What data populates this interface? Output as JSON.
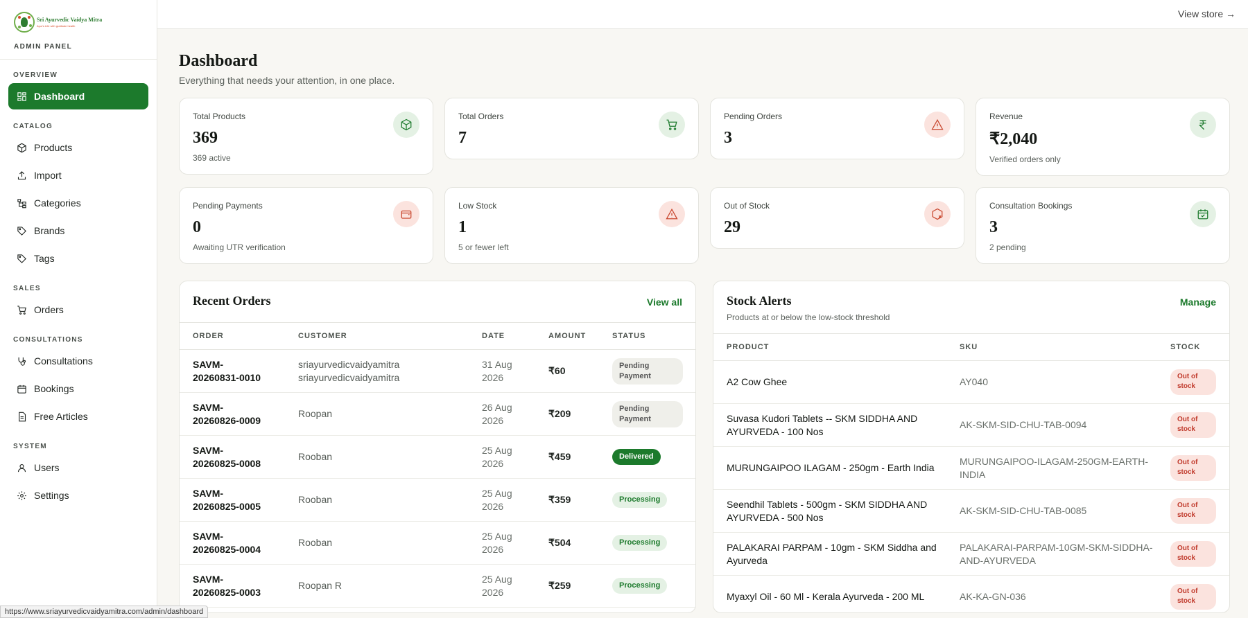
{
  "brand": {
    "logo_name": "Sri Ayurvedic Vaidya Mitra",
    "logo_tag": "Ayur's Life with gratitude health",
    "panel_label": "ADMIN PANEL"
  },
  "sidebar": {
    "sections": [
      {
        "title": "OVERVIEW",
        "items": [
          {
            "label": "Dashboard",
            "icon": "dashboard-icon",
            "active": true
          }
        ]
      },
      {
        "title": "CATALOG",
        "items": [
          {
            "label": "Products",
            "icon": "box-icon"
          },
          {
            "label": "Import",
            "icon": "upload-icon"
          },
          {
            "label": "Categories",
            "icon": "tree-icon"
          },
          {
            "label": "Brands",
            "icon": "tag-icon"
          },
          {
            "label": "Tags",
            "icon": "tags-icon"
          }
        ]
      },
      {
        "title": "SALES",
        "items": [
          {
            "label": "Orders",
            "icon": "cart-icon"
          }
        ]
      },
      {
        "title": "CONSULTATIONS",
        "items": [
          {
            "label": "Consultations",
            "icon": "stethoscope-icon"
          },
          {
            "label": "Bookings",
            "icon": "calendar-icon"
          },
          {
            "label": "Free Articles",
            "icon": "document-icon"
          }
        ]
      },
      {
        "title": "SYSTEM",
        "items": [
          {
            "label": "Users",
            "icon": "user-icon"
          },
          {
            "label": "Settings",
            "icon": "gear-icon"
          }
        ]
      }
    ]
  },
  "topbar": {
    "view_store": "View store →"
  },
  "page": {
    "title": "Dashboard",
    "subtitle": "Everything that needs your attention, in one place."
  },
  "stats": [
    {
      "label": "Total Products",
      "value": "369",
      "note": "369 active",
      "icon": "box-icon",
      "tone": "green"
    },
    {
      "label": "Total Orders",
      "value": "7",
      "note": "",
      "icon": "cart-icon",
      "tone": "green"
    },
    {
      "label": "Pending Orders",
      "value": "3",
      "note": "",
      "icon": "warning-icon",
      "tone": "red"
    },
    {
      "label": "Revenue",
      "value": "₹2,040",
      "note": "Verified orders only",
      "icon": "rupee-icon",
      "tone": "green"
    },
    {
      "label": "Pending Payments",
      "value": "0",
      "note": "Awaiting UTR verification",
      "icon": "wallet-icon",
      "tone": "red"
    },
    {
      "label": "Low Stock",
      "value": "1",
      "note": "5 or fewer left",
      "icon": "warning-icon",
      "tone": "red"
    },
    {
      "label": "Out of Stock",
      "value": "29",
      "note": "",
      "icon": "box-x-icon",
      "tone": "red"
    },
    {
      "label": "Consultation Bookings",
      "value": "3",
      "note": "2 pending",
      "icon": "calendar-check-icon",
      "tone": "green"
    }
  ],
  "recent_orders": {
    "title": "Recent Orders",
    "link": "View all",
    "columns": [
      "ORDER",
      "CUSTOMER",
      "DATE",
      "AMOUNT",
      "STATUS"
    ],
    "rows": [
      {
        "order_a": "SAVM-",
        "order_b": "20260831-0010",
        "cust_a": "sriayurvedicvaidyamitra",
        "cust_b": "sriayurvedicvaidyamitra",
        "date_a": "31 Aug",
        "date_b": "2026",
        "amount": "₹60",
        "status_a": "Pending",
        "status_b": "Payment",
        "status_type": "pending"
      },
      {
        "order_a": "SAVM-",
        "order_b": "20260826-0009",
        "cust_a": "Roopan",
        "cust_b": "",
        "date_a": "26 Aug",
        "date_b": "2026",
        "amount": "₹209",
        "status_a": "Pending",
        "status_b": "Payment",
        "status_type": "pending"
      },
      {
        "order_a": "SAVM-",
        "order_b": "20260825-0008",
        "cust_a": "Rooban",
        "cust_b": "",
        "date_a": "25 Aug",
        "date_b": "2026",
        "amount": "₹459",
        "status_a": "Delivered",
        "status_b": "",
        "status_type": "delivered"
      },
      {
        "order_a": "SAVM-",
        "order_b": "20260825-0005",
        "cust_a": "Rooban",
        "cust_b": "",
        "date_a": "25 Aug",
        "date_b": "2026",
        "amount": "₹359",
        "status_a": "Processing",
        "status_b": "",
        "status_type": "processing"
      },
      {
        "order_a": "SAVM-",
        "order_b": "20260825-0004",
        "cust_a": "Rooban",
        "cust_b": "",
        "date_a": "25 Aug",
        "date_b": "2026",
        "amount": "₹504",
        "status_a": "Processing",
        "status_b": "",
        "status_type": "processing"
      },
      {
        "order_a": "SAVM-",
        "order_b": "20260825-0003",
        "cust_a": "Roopan R",
        "cust_b": "",
        "date_a": "25 Aug",
        "date_b": "2026",
        "amount": "₹259",
        "status_a": "Processing",
        "status_b": "",
        "status_type": "processing"
      }
    ]
  },
  "stock_alerts": {
    "title": "Stock Alerts",
    "subtitle": "Products at or below the low-stock threshold",
    "link": "Manage",
    "columns": [
      "PRODUCT",
      "SKU",
      "STOCK"
    ],
    "rows": [
      {
        "product": "A2 Cow Ghee",
        "sku": "AY040",
        "stock_a": "Out of",
        "stock_b": "stock"
      },
      {
        "product": "Suvasa Kudori Tablets -- SKM SIDDHA AND AYURVEDA - 100 Nos",
        "sku": "AK-SKM-SID-CHU-TAB-0094",
        "stock_a": "Out of",
        "stock_b": "stock"
      },
      {
        "product": "MURUNGAIPOO ILAGAM - 250gm - Earth India",
        "sku": "MURUNGAIPOO-ILAGAM-250GM-EARTH-INDIA",
        "stock_a": "Out of",
        "stock_b": "stock"
      },
      {
        "product": "Seendhil Tablets - 500gm - SKM SIDDHA AND AYURVEDA - 500 Nos",
        "sku": "AK-SKM-SID-CHU-TAB-0085",
        "stock_a": "Out of",
        "stock_b": "stock"
      },
      {
        "product": "PALAKARAI PARPAM - 10gm - SKM Siddha and Ayurveda",
        "sku": "PALAKARAI-PARPAM-10GM-SKM-SIDDHA-AND-AYURVEDA",
        "stock_a": "Out of",
        "stock_b": "stock"
      },
      {
        "product": "Myaxyl Oil - 60 Ml - Kerala Ayurveda - 200 ML",
        "sku": "AK-KA-GN-036",
        "stock_a": "Out of",
        "stock_b": "stock"
      }
    ]
  },
  "status_url": "https://www.sriayurvedicvaidyamitra.com/admin/dashboard",
  "colors": {
    "accent": "#1c7a2c",
    "danger": "#c8452c",
    "background": "#f8f7f3"
  }
}
